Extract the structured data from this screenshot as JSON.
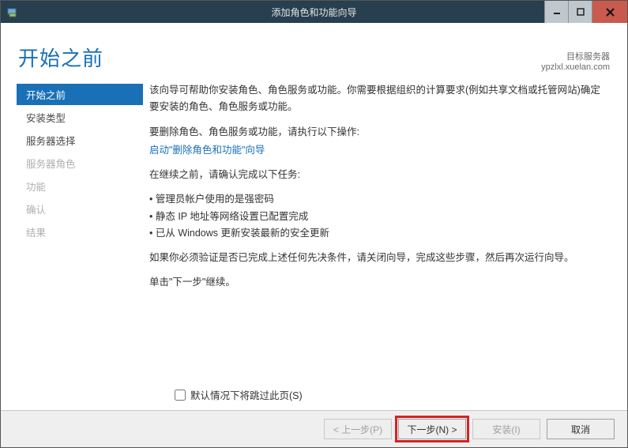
{
  "window": {
    "title": "添加角色和功能向导"
  },
  "header": {
    "page_title": "开始之前",
    "server_label": "目标服务器",
    "server_name": "ypzlxl.xuelan.com"
  },
  "sidebar": {
    "items": [
      {
        "label": "开始之前",
        "state": "active"
      },
      {
        "label": "安装类型",
        "state": "enabled"
      },
      {
        "label": "服务器选择",
        "state": "enabled"
      },
      {
        "label": "服务器角色",
        "state": "disabled"
      },
      {
        "label": "功能",
        "state": "disabled"
      },
      {
        "label": "确认",
        "state": "disabled"
      },
      {
        "label": "结果",
        "state": "disabled"
      }
    ]
  },
  "body": {
    "intro": "该向导可帮助你安装角色、角色服务或功能。你需要根据组织的计算要求(例如共享文档或托管网站)确定要安装的角色、角色服务或功能。",
    "remove_prompt": "要删除角色、角色服务或功能，请执行以下操作:",
    "remove_link": "启动\"删除角色和功能\"向导",
    "pre_check_prompt": "在继续之前，请确认完成以下任务:",
    "checks": [
      "管理员帐户使用的是强密码",
      "静态 IP 地址等网络设置已配置完成",
      "已从 Windows 更新安装最新的安全更新"
    ],
    "verify_note": "如果你必须验证是否已完成上述任何先决条件，请关闭向导，完成这些步骤，然后再次运行向导。",
    "continue_note": "单击\"下一步\"继续。"
  },
  "skip": {
    "label": "默认情况下将跳过此页(S)"
  },
  "footer": {
    "prev": "< 上一步(P)",
    "next": "下一步(N) >",
    "install": "安装(I)",
    "cancel": "取消"
  }
}
